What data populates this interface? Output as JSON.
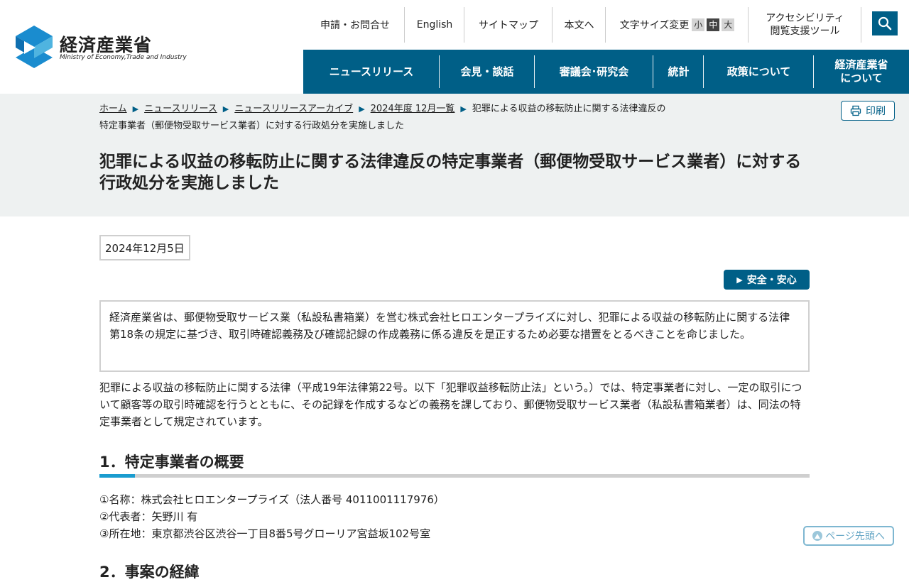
{
  "header": {
    "logo_ja": "経済産業省",
    "logo_en": "Ministry of Economy,Trade and Industry",
    "util": {
      "contact": "申請・お問合せ",
      "english": "English",
      "sitemap": "サイトマップ",
      "skip": "本文へ",
      "font_size_label": "文字サイズ変更",
      "font_small": "小",
      "font_medium": "中",
      "font_large": "大",
      "accessibility_line1": "アクセシビリティ",
      "accessibility_line2": "閲覧支援ツール"
    },
    "nav": [
      {
        "label": "ニュースリリース"
      },
      {
        "label": "会見・談話"
      },
      {
        "label": "審議会･研究会"
      },
      {
        "label": "統計"
      },
      {
        "label": "政策について"
      },
      {
        "label_line1": "経済産業省",
        "label_line2": "について"
      }
    ]
  },
  "breadcrumb": {
    "items": [
      "ホーム",
      "ニュースリリース",
      "ニュースリリースアーカイブ",
      "2024年度 12月一覧"
    ],
    "current": "犯罪による収益の移転防止に関する法律違反の特定事業者（郵便物受取サービス業者）に対する行政処分を実施しました"
  },
  "print_label": "印刷",
  "page_title": "犯罪による収益の移転防止に関する法律違反の特定事業者（郵便物受取サービス業者）に対する行政処分を実施しました",
  "date": "2024年12月5日",
  "category_tag": "安全・安心",
  "summary": "経済産業省は、郵便物受取サービス業（私設私書箱業）を営む株式会社ヒロエンタープライズに対し、犯罪による収益の移転防止に関する法律第18条の規定に基づき、取引時確認義務及び確認記録の作成義務に係る違反を是正するため必要な措置をとるべきことを命じました。",
  "intro_paragraph": "犯罪による収益の移転防止に関する法律（平成19年法律第22号。以下「犯罪収益移転防止法」という。）では、特定事業者に対し、一定の取引について顧客等の取引時確認を行うとともに、その記録を作成するなどの義務を課しており、郵便物受取サービス業者（私設私書箱業者）は、同法の特定事業者として規定されています。",
  "section1": {
    "heading": "1．特定事業者の概要",
    "items": [
      "①名称：株式会社ヒロエンタープライズ（法人番号 4011001117976）",
      "②代表者：矢野川 有",
      "③所在地：東京都渋谷区渋谷一丁目8番5号グローリア宮益坂102号室"
    ]
  },
  "section2": {
    "heading": "2．事案の経緯"
  },
  "page_top_label": "ページ先頭へ",
  "colors": {
    "brand": "#005f87",
    "band_bg": "#eef1f1",
    "accent_line": "#1a9ccf"
  }
}
